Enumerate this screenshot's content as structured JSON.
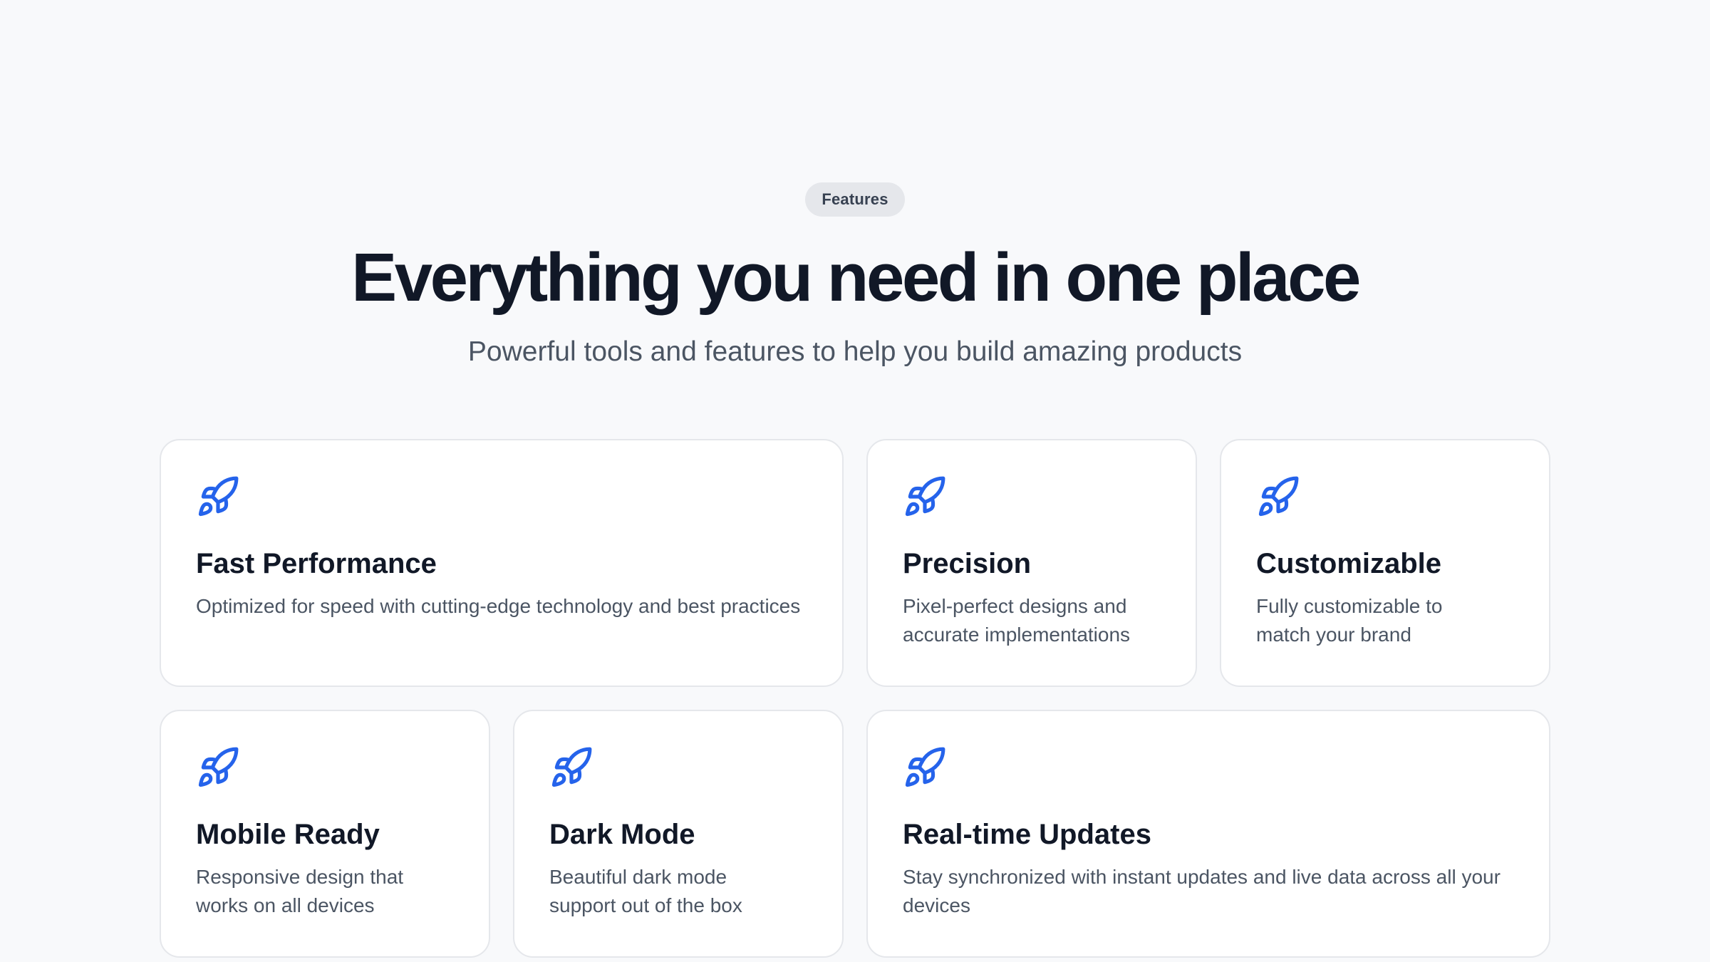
{
  "section": {
    "eyebrow": "Features",
    "headline": "Everything you need in one place",
    "subhead": "Powerful tools and features to help you build amazing products"
  },
  "colors": {
    "accent": "#2563eb",
    "background": "#f8f9fb",
    "card_background": "#ffffff",
    "card_border": "#e5e7eb",
    "heading": "#111827",
    "body_text": "#4b5563",
    "badge_background": "#e5e7eb"
  },
  "features": [
    {
      "icon": "rocket-icon",
      "title": "Fast Performance",
      "description": "Optimized for speed with cutting-edge technology and best practices"
    },
    {
      "icon": "rocket-icon",
      "title": "Precision",
      "description": "Pixel-perfect designs and accurate implementations"
    },
    {
      "icon": "rocket-icon",
      "title": "Customizable",
      "description": "Fully customizable to match your brand"
    },
    {
      "icon": "rocket-icon",
      "title": "Mobile Ready",
      "description": "Responsive design that works on all devices"
    },
    {
      "icon": "rocket-icon",
      "title": "Dark Mode",
      "description": "Beautiful dark mode support out of the box"
    },
    {
      "icon": "rocket-icon",
      "title": "Real-time Updates",
      "description": "Stay synchronized with instant updates and live data across all your devices"
    }
  ]
}
